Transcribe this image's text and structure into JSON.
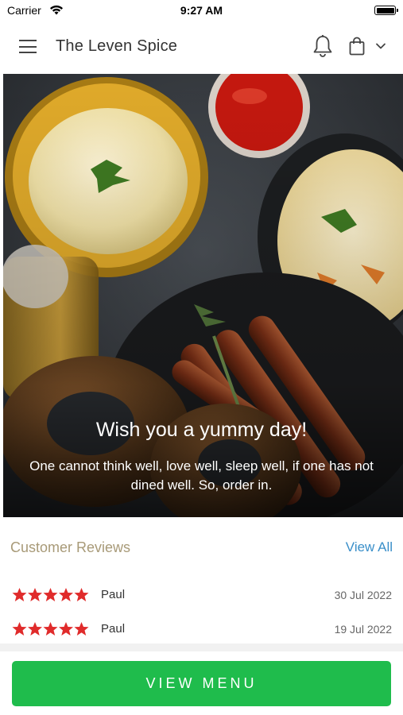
{
  "status_bar": {
    "carrier": "Carrier",
    "time": "9:27 AM"
  },
  "header": {
    "title": "The Leven Spice",
    "menu_icon": "hamburger-menu-icon",
    "notification_icon": "bell-icon",
    "cart_icon": "shopping-bag-icon",
    "dropdown_icon": "chevron-down-icon"
  },
  "hero": {
    "title": "Wish you a yummy day!",
    "subtitle": "One cannot think well, love well, sleep well, if one has not dined well. So, order in."
  },
  "reviews": {
    "heading": "Customer Reviews",
    "view_all_label": "View All",
    "items": [
      {
        "name": "Paul",
        "date": "30 Jul 2022",
        "rating": 5
      },
      {
        "name": "Paul",
        "date": "19 Jul 2022",
        "rating": 5
      }
    ]
  },
  "cta": {
    "label": "VIEW MENU"
  },
  "colors": {
    "accent_green": "#1fbc4c",
    "link_blue": "#3a8fc9",
    "heading_tan": "#a89a78",
    "star_red": "#e02b2b"
  }
}
